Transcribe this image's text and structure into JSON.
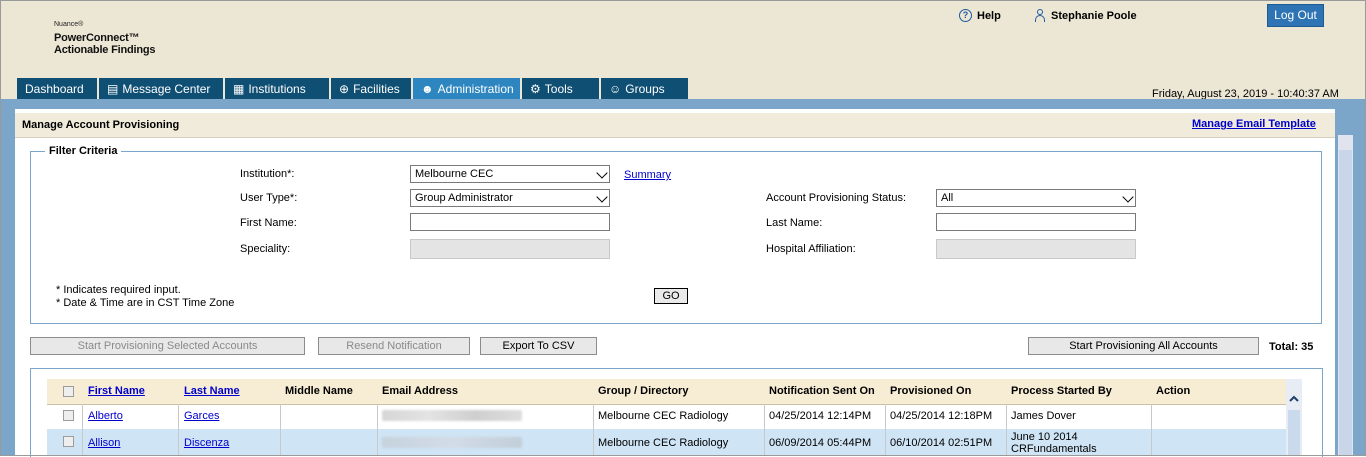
{
  "header": {
    "brand_small": "Nuance®",
    "brand_line1": "PowerConnect™",
    "brand_line2": "Actionable Findings",
    "help_label": "Help",
    "user_name": "Stephanie Poole",
    "logout_label": "Log Out",
    "datetime": "Friday, August 23, 2019 - 10:40:37 AM"
  },
  "tabs": [
    {
      "label": "Dashboard",
      "icon": "none",
      "active": false
    },
    {
      "label": "Message Center",
      "icon": "message-icon",
      "active": false
    },
    {
      "label": "Institutions",
      "icon": "building-icon",
      "active": false
    },
    {
      "label": "Facilities",
      "icon": "plus-circle-icon",
      "active": false
    },
    {
      "label": "Administration",
      "icon": "admin-user-icon",
      "active": true
    },
    {
      "label": "Tools",
      "icon": "gears-icon",
      "active": false
    },
    {
      "label": "Groups",
      "icon": "group-icon",
      "active": false
    }
  ],
  "page": {
    "title": "Manage Account Provisioning",
    "manage_template_link": "Manage Email Template"
  },
  "filter": {
    "legend": "Filter Criteria",
    "institution_label": "Institution*:",
    "institution_value": "Melbourne CEC",
    "summary_link": "Summary",
    "user_type_label": "User Type*:",
    "user_type_value": "Group Administrator",
    "status_label": "Account Provisioning Status:",
    "status_value": "All",
    "first_name_label": "First Name:",
    "last_name_label": "Last Name:",
    "speciality_label": "Speciality:",
    "hospital_label": "Hospital Affiliation:",
    "note_required": "* Indicates required input.",
    "note_timezone": "* Date & Time are in CST Time Zone",
    "go_label": "GO"
  },
  "actions": {
    "start_selected": "Start Provisioning Selected Accounts",
    "resend": "Resend Notification",
    "export_csv": "Export To CSV",
    "start_all": "Start Provisioning All Accounts",
    "total": "Total: 35"
  },
  "table": {
    "headers": {
      "first_name": "First Name",
      "last_name": "Last Name",
      "middle_name": "Middle Name",
      "email": "Email Address",
      "group": "Group / Directory",
      "notification_sent": "Notification Sent On",
      "provisioned_on": "Provisioned On",
      "process_started_by": "Process Started By",
      "action": "Action"
    },
    "rows": [
      {
        "first": "Alberto",
        "last": "Garces",
        "middle": "",
        "group": "Melbourne CEC Radiology",
        "notified": "04/25/2014 12:14PM",
        "provisioned": "04/25/2014 12:18PM",
        "started_by_1": "James Dover",
        "started_by_2": ""
      },
      {
        "first": "Allison",
        "last": "Discenza",
        "middle": "",
        "group": "Melbourne CEC Radiology",
        "notified": "06/09/2014 05:44PM",
        "provisioned": "06/10/2014 02:51PM",
        "started_by_1": "June 10 2014",
        "started_by_2": "CRFundamentals"
      }
    ]
  }
}
